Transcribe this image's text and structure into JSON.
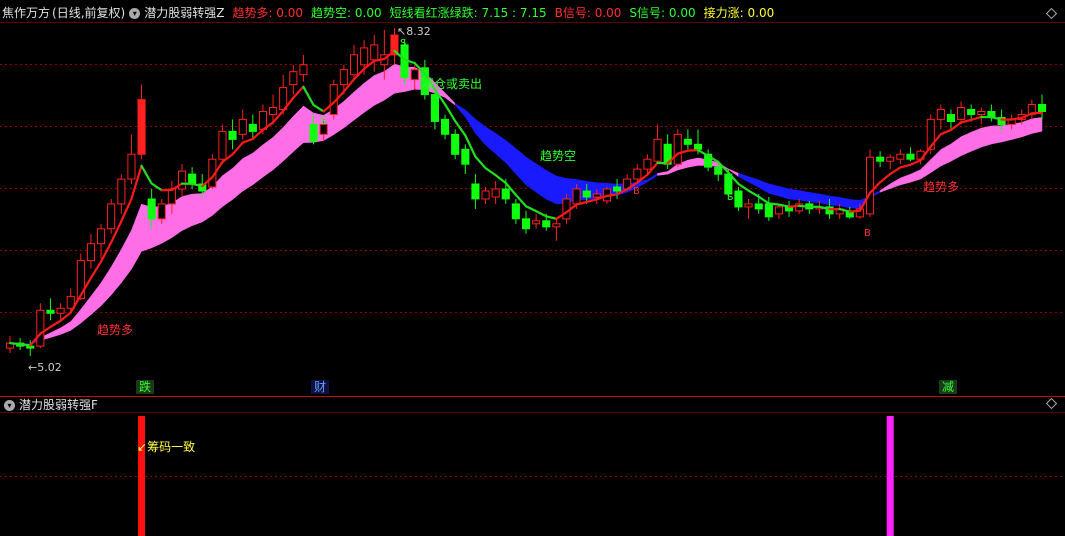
{
  "main_header": {
    "stock_name": "焦作万方",
    "period": "(日线,前复权)",
    "indicator": "潜力股弱转强Z",
    "fields": [
      {
        "label": "趋势多",
        "value": "0.00",
        "color": "#ff3030"
      },
      {
        "label": "趋势空",
        "value": "0.00",
        "color": "#30ff30"
      },
      {
        "label": "短线看红涨绿跌",
        "value": "7.15 : 7.15",
        "color": "#30ff30"
      },
      {
        "label": "B信号",
        "value": "0.00",
        "color": "#ff3030"
      },
      {
        "label": "S信号",
        "value": "0.00",
        "color": "#30ff30"
      },
      {
        "label": "接力涨",
        "value": "0.00",
        "color": "#ffff30"
      }
    ]
  },
  "sub_header": {
    "indicator": "潜力股弱转强F"
  },
  "price_labels": {
    "high": "8.32",
    "low": "5.02"
  },
  "annotations": {
    "trend_long_1": "趋势多",
    "trend_short": "趋势空",
    "reduce_sell": "减仓或卖出",
    "trend_long_2": "趋势多",
    "chip_consistent": "筹码一致"
  },
  "bottom_tags": [
    "跌",
    "财",
    "减"
  ],
  "signal_letters": {
    "s": "S",
    "b": "B"
  },
  "colors": {
    "up": "#ff2020",
    "down": "#10ff10",
    "ribbon_pink": "#ff6ee6",
    "ribbon_blue": "#1a1aff",
    "line_red": "#ff1a1a",
    "line_green": "#20e020",
    "grid": "#8a0000",
    "yellow": "#ffff40",
    "magenta": "#ff20ff"
  },
  "chart_data": {
    "type": "candlestick",
    "ohlc": [
      [
        5.1,
        5.22,
        5.05,
        5.15
      ],
      [
        5.15,
        5.2,
        5.08,
        5.12
      ],
      [
        5.12,
        5.18,
        5.02,
        5.1
      ],
      [
        5.12,
        5.55,
        5.1,
        5.48
      ],
      [
        5.48,
        5.6,
        5.38,
        5.45
      ],
      [
        5.45,
        5.55,
        5.38,
        5.5
      ],
      [
        5.5,
        5.7,
        5.45,
        5.62
      ],
      [
        5.6,
        6.05,
        5.58,
        5.98
      ],
      [
        5.98,
        6.25,
        5.9,
        6.15
      ],
      [
        6.15,
        6.35,
        6.0,
        6.3
      ],
      [
        6.3,
        6.6,
        6.25,
        6.55
      ],
      [
        6.55,
        6.85,
        6.45,
        6.8
      ],
      [
        6.8,
        7.25,
        6.75,
        7.05
      ],
      [
        7.05,
        7.75,
        7.0,
        7.6
      ],
      [
        6.6,
        6.7,
        6.3,
        6.4
      ],
      [
        6.4,
        6.6,
        6.35,
        6.55
      ],
      [
        6.55,
        6.78,
        6.45,
        6.7
      ],
      [
        6.7,
        6.95,
        6.62,
        6.88
      ],
      [
        6.85,
        6.92,
        6.7,
        6.75
      ],
      [
        6.75,
        6.85,
        6.62,
        6.68
      ],
      [
        6.72,
        7.05,
        6.7,
        7.0
      ],
      [
        7.0,
        7.35,
        6.95,
        7.28
      ],
      [
        7.28,
        7.4,
        7.1,
        7.2
      ],
      [
        7.25,
        7.5,
        7.2,
        7.4
      ],
      [
        7.35,
        7.45,
        7.2,
        7.28
      ],
      [
        7.3,
        7.55,
        7.25,
        7.48
      ],
      [
        7.45,
        7.65,
        7.35,
        7.52
      ],
      [
        7.5,
        7.85,
        7.45,
        7.72
      ],
      [
        7.75,
        7.95,
        7.65,
        7.88
      ],
      [
        7.85,
        8.05,
        7.78,
        7.95
      ],
      [
        7.35,
        7.45,
        7.15,
        7.18
      ],
      [
        7.25,
        7.4,
        7.18,
        7.35
      ],
      [
        7.45,
        7.8,
        7.4,
        7.75
      ],
      [
        7.75,
        7.95,
        7.65,
        7.9
      ],
      [
        7.85,
        8.15,
        7.8,
        8.05
      ],
      [
        7.95,
        8.2,
        7.85,
        8.12
      ],
      [
        8.0,
        8.25,
        7.88,
        8.15
      ],
      [
        7.95,
        8.3,
        7.8,
        8.05
      ],
      [
        8.05,
        8.32,
        7.95,
        8.25
      ],
      [
        8.15,
        8.2,
        7.75,
        7.82
      ],
      [
        7.8,
        7.95,
        7.7,
        7.9
      ],
      [
        7.92,
        8.0,
        7.6,
        7.65
      ],
      [
        7.65,
        7.7,
        7.3,
        7.38
      ],
      [
        7.4,
        7.45,
        7.2,
        7.25
      ],
      [
        7.25,
        7.3,
        7.0,
        7.05
      ],
      [
        7.1,
        7.15,
        6.85,
        6.95
      ],
      [
        6.75,
        6.85,
        6.5,
        6.6
      ],
      [
        6.6,
        6.72,
        6.55,
        6.68
      ],
      [
        6.62,
        6.78,
        6.55,
        6.7
      ],
      [
        6.7,
        6.8,
        6.55,
        6.6
      ],
      [
        6.55,
        6.6,
        6.35,
        6.4
      ],
      [
        6.4,
        6.48,
        6.25,
        6.3
      ],
      [
        6.35,
        6.45,
        6.3,
        6.38
      ],
      [
        6.38,
        6.45,
        6.28,
        6.32
      ],
      [
        6.32,
        6.4,
        6.18,
        6.35
      ],
      [
        6.4,
        6.65,
        6.35,
        6.6
      ],
      [
        6.55,
        6.75,
        6.5,
        6.7
      ],
      [
        6.68,
        6.75,
        6.55,
        6.62
      ],
      [
        6.62,
        6.7,
        6.55,
        6.65
      ],
      [
        6.58,
        6.72,
        6.55,
        6.7
      ],
      [
        6.72,
        6.8,
        6.6,
        6.68
      ],
      [
        6.7,
        6.85,
        6.68,
        6.8
      ],
      [
        6.8,
        6.95,
        6.75,
        6.9
      ],
      [
        6.9,
        7.05,
        6.85,
        7.0
      ],
      [
        6.98,
        7.35,
        6.95,
        7.2
      ],
      [
        7.15,
        7.25,
        6.9,
        6.95
      ],
      [
        6.95,
        7.3,
        6.92,
        7.25
      ],
      [
        7.2,
        7.3,
        7.1,
        7.15
      ],
      [
        7.15,
        7.3,
        7.05,
        7.1
      ],
      [
        7.05,
        7.1,
        6.88,
        6.92
      ],
      [
        6.92,
        6.98,
        6.78,
        6.85
      ],
      [
        6.85,
        6.9,
        6.6,
        6.65
      ],
      [
        6.68,
        6.72,
        6.48,
        6.52
      ],
      [
        6.52,
        6.6,
        6.4,
        6.55
      ],
      [
        6.55,
        6.65,
        6.45,
        6.5
      ],
      [
        6.55,
        6.62,
        6.38,
        6.42
      ],
      [
        6.45,
        6.55,
        6.4,
        6.52
      ],
      [
        6.52,
        6.58,
        6.42,
        6.48
      ],
      [
        6.48,
        6.6,
        6.45,
        6.55
      ],
      [
        6.55,
        6.58,
        6.45,
        6.5
      ],
      [
        6.5,
        6.58,
        6.45,
        6.52
      ],
      [
        6.52,
        6.6,
        6.4,
        6.45
      ],
      [
        6.45,
        6.55,
        6.4,
        6.5
      ],
      [
        6.48,
        6.52,
        6.4,
        6.42
      ],
      [
        6.42,
        6.55,
        6.4,
        6.5
      ],
      [
        6.45,
        7.1,
        6.42,
        7.02
      ],
      [
        7.02,
        7.08,
        6.92,
        6.98
      ],
      [
        6.98,
        7.05,
        6.9,
        7.02
      ],
      [
        7.0,
        7.1,
        6.95,
        7.05
      ],
      [
        7.05,
        7.12,
        6.98,
        7.0
      ],
      [
        7.0,
        7.1,
        6.95,
        7.08
      ],
      [
        7.1,
        7.45,
        7.05,
        7.4
      ],
      [
        7.4,
        7.55,
        7.3,
        7.5
      ],
      [
        7.45,
        7.5,
        7.3,
        7.38
      ],
      [
        7.4,
        7.58,
        7.35,
        7.52
      ],
      [
        7.5,
        7.55,
        7.38,
        7.45
      ],
      [
        7.45,
        7.52,
        7.35,
        7.48
      ],
      [
        7.48,
        7.55,
        7.38,
        7.42
      ],
      [
        7.42,
        7.5,
        7.28,
        7.35
      ],
      [
        7.35,
        7.45,
        7.3,
        7.4
      ],
      [
        7.4,
        7.5,
        7.35,
        7.45
      ],
      [
        7.45,
        7.6,
        7.4,
        7.55
      ],
      [
        7.55,
        7.65,
        7.4,
        7.48
      ]
    ],
    "bottom_bars": [
      {
        "index": 13,
        "value": 1.0,
        "color": "#ff1010"
      },
      {
        "index": 87,
        "value": 1.0,
        "color": "#ff20ff"
      }
    ]
  }
}
